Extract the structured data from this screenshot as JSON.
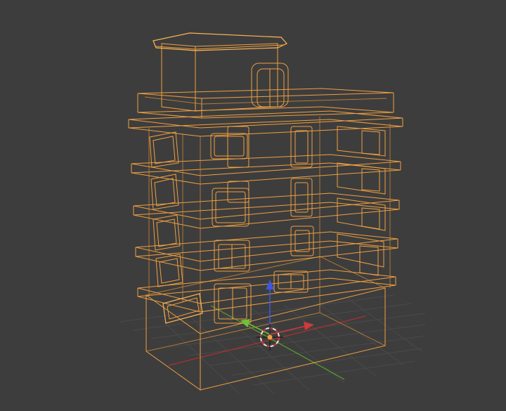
{
  "viewport": {
    "mode": "3d-viewport",
    "shading": "wireframe",
    "selected_object": "building",
    "wire_color": "#f0a040",
    "background_color": "#3d3d3d"
  },
  "axes": {
    "x_color": "#d03a3a",
    "y_color": "#6fc03a",
    "z_color": "#3a58e0"
  },
  "gizmo": {
    "type": "move",
    "icon": "3d-cursor-icon"
  }
}
